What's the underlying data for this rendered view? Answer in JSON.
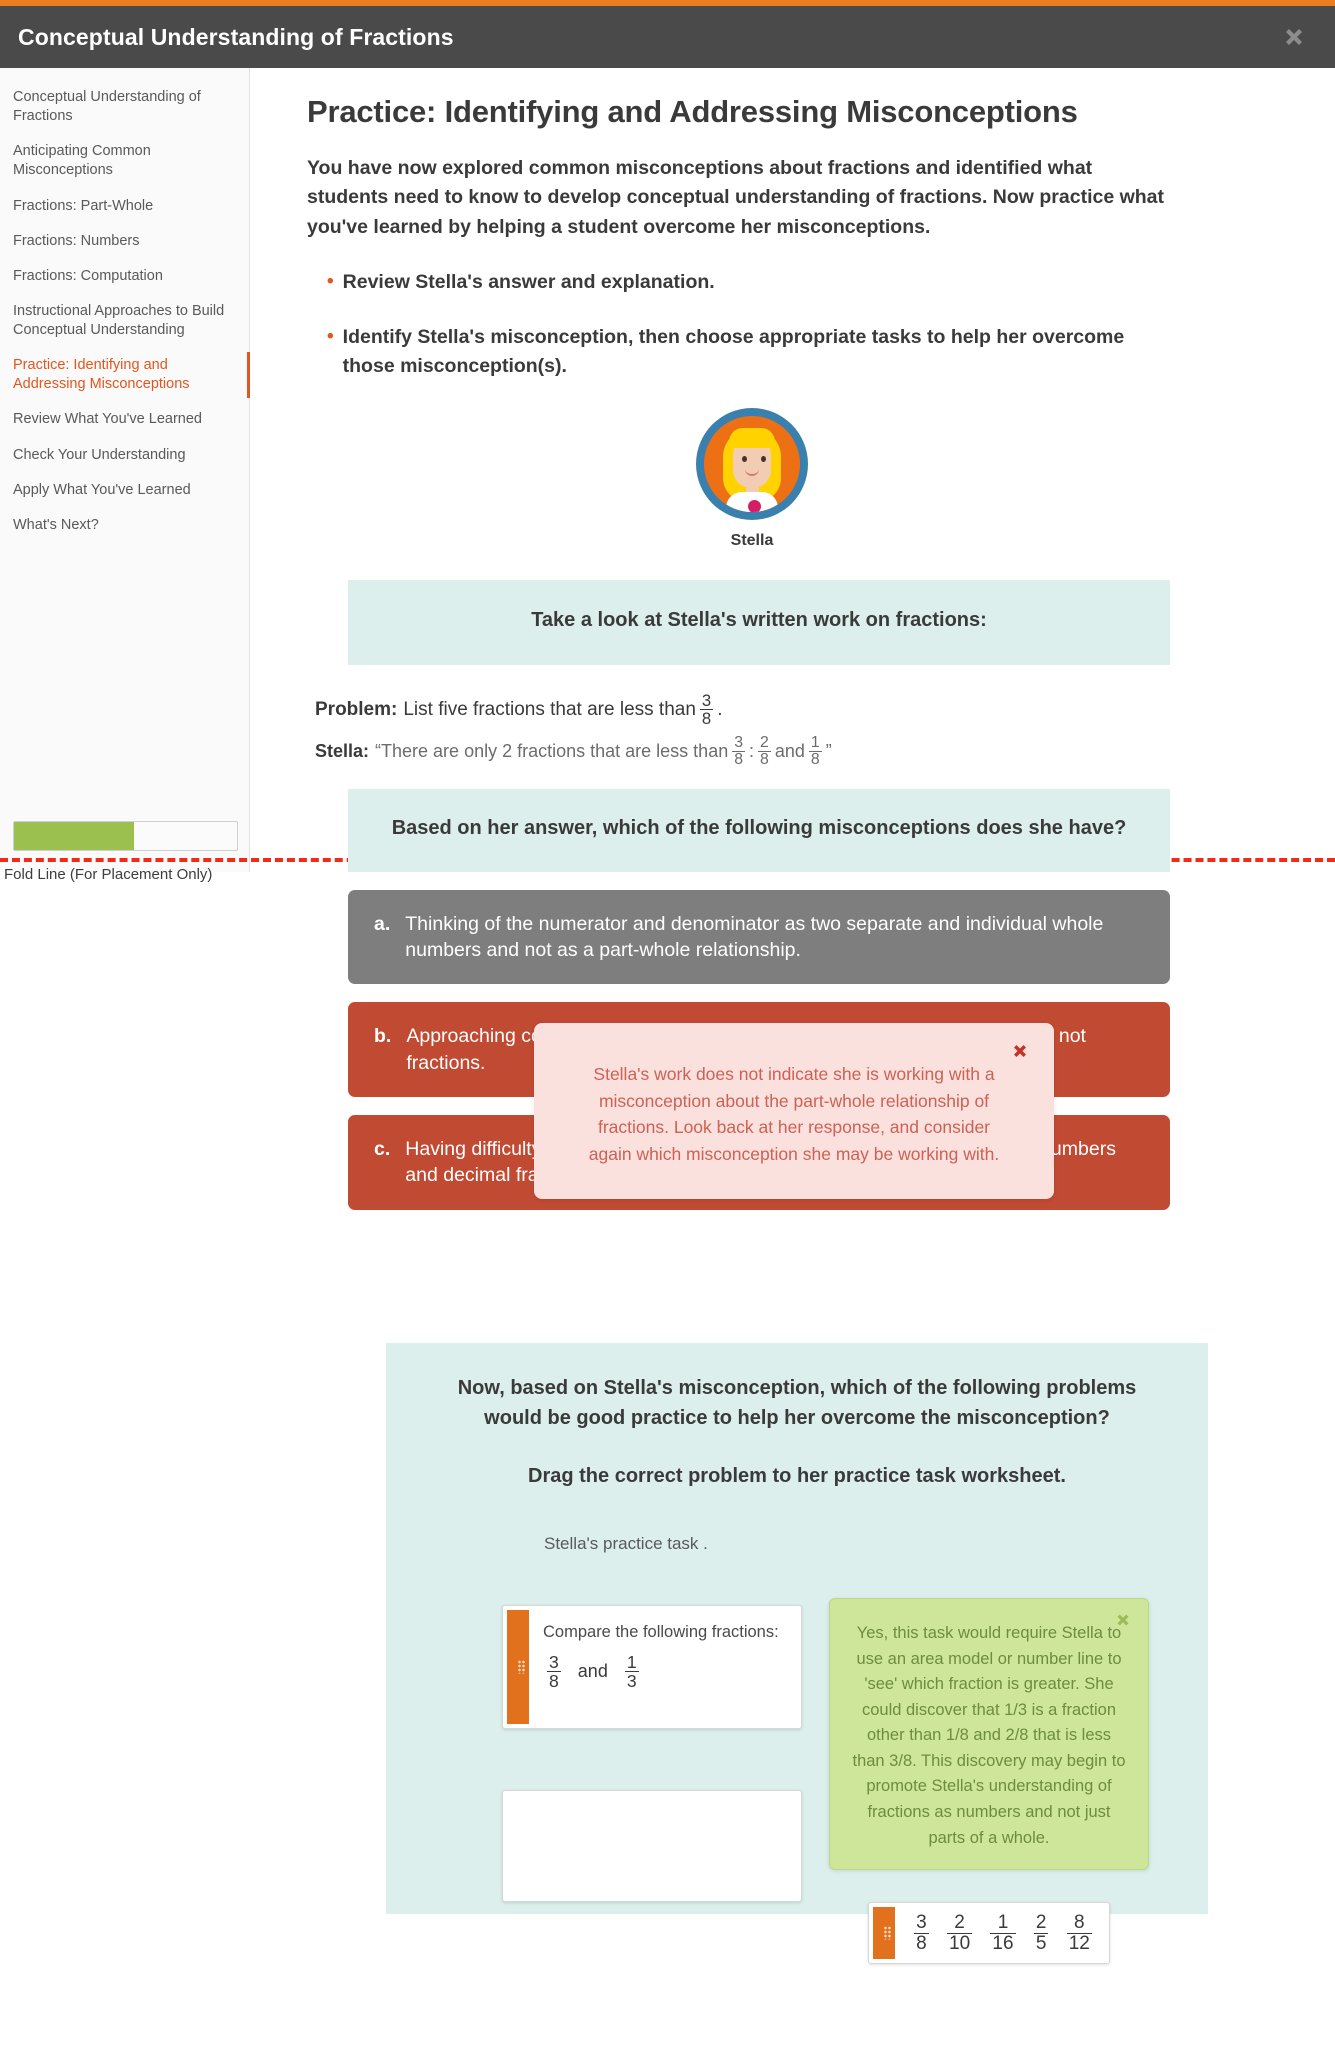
{
  "window": {
    "title": "Conceptual Understanding of Fractions",
    "close_icon": "close-icon"
  },
  "sidebar": {
    "items": [
      {
        "label": "Conceptual Understanding of Fractions",
        "active": false
      },
      {
        "label": "Anticipating Common Misconceptions",
        "active": false
      },
      {
        "label": "Fractions: Part-Whole",
        "active": false
      },
      {
        "label": "Fractions: Numbers",
        "active": false
      },
      {
        "label": "Fractions: Computation",
        "active": false
      },
      {
        "label": "Instructional Approaches to Build Conceptual Understanding",
        "active": false
      },
      {
        "label": "Practice: Identifying and Addressing Misconceptions",
        "active": true
      },
      {
        "label": "Review What You've Learned",
        "active": false
      },
      {
        "label": "Check Your Understanding",
        "active": false
      },
      {
        "label": "Apply What You've Learned",
        "active": false
      },
      {
        "label": "What's Next?",
        "active": false
      }
    ],
    "progress_percent": 54
  },
  "fold": {
    "label": "Fold Line (For Placement Only)"
  },
  "main": {
    "heading": "Practice: Identifying and Addressing Misconceptions",
    "intro": "You have now explored common misconceptions about fractions and identified what students need to know to develop conceptual understanding of fractions. Now practice what you've learned by helping a student overcome her misconceptions.",
    "bullets": [
      "Review Stella's answer and explanation.",
      "Identify Stella's misconception, then choose appropriate tasks to help her overcome those misconception(s)."
    ],
    "avatar_name": "Stella",
    "band_written_work": "Take a look at Stella's written work on fractions:",
    "problem": {
      "label": "Problem:",
      "text_before": "List five fractions that are less than",
      "fraction": {
        "num": "3",
        "den": "8"
      },
      "text_after": "."
    },
    "stella_answer": {
      "label": "Stella:",
      "text_before": "“There are only 2 fractions that are less than",
      "f1": {
        "num": "3",
        "den": "8"
      },
      "sep": ":",
      "f2": {
        "num": "2",
        "den": "8"
      },
      "conj": "and",
      "f3": {
        "num": "1",
        "den": "8"
      },
      "text_after": "”"
    },
    "band_question": "Based on her answer, which of the following misconceptions does she have?",
    "options": [
      {
        "letter": "a.",
        "text": "Thinking of the numerator and denominator as two separate and individual whole numbers and not as a part-whole relationship.",
        "state": "grey"
      },
      {
        "letter": "b.",
        "text": "Approaching computation with fractions as if they were whole numbers and not fractions.",
        "state": "red"
      },
      {
        "letter": "c.",
        "text": "Having difficulty understanding that fractions are numbers, just like whole numbers and decimal fractions.",
        "state": "red"
      }
    ],
    "feedback_red": {
      "text": "Stella's work does not indicate she is working with a misconception about the part-whole relationship of fractions. Look back at her response, and consider again which misconception she may be working with.",
      "close_icon": "close-icon"
    },
    "drag_section": {
      "question": "Now, based on Stella's misconception, which of the following problems would be good practice to help her overcome the misconception?",
      "instruction": "Drag the correct problem to her practice task worksheet.",
      "worksheet_label": "Stella's  practice task .",
      "task_card": {
        "prompt": "Compare the following fractions:",
        "f1": {
          "num": "3",
          "den": "8"
        },
        "conj": "and",
        "f2": {
          "num": "1",
          "den": "3"
        }
      },
      "drop_zone": {
        "label": ""
      },
      "fraction_strip": [
        {
          "num": "3",
          "den": "8"
        },
        {
          "num": "2",
          "den": "10"
        },
        {
          "num": "1",
          "den": "16"
        },
        {
          "num": "2",
          "den": "5"
        },
        {
          "num": "8",
          "den": "12"
        }
      ],
      "feedback_green": {
        "text": "Yes, this task would require Stella to use an area model or number line to 'see' which fraction is greater. She could discover that 1/3 is a fraction other than 1/8 and 2/8 that is less than 3/8. This discovery may begin to promote Stella's understanding of fractions as numbers and not just parts of a whole.",
        "close_icon": "close-icon"
      }
    }
  },
  "colors": {
    "accent_orange": "#ED7B20",
    "active_orange": "#E2561F",
    "titlebar": "#4A4A4A",
    "teal_band": "#DCEFEC",
    "option_grey": "#7E7E7E",
    "option_red": "#C14A33",
    "progress_green": "#9CC04F",
    "popup_red_bg": "#FBE1DE",
    "popup_green_bg": "#CDE69A"
  }
}
